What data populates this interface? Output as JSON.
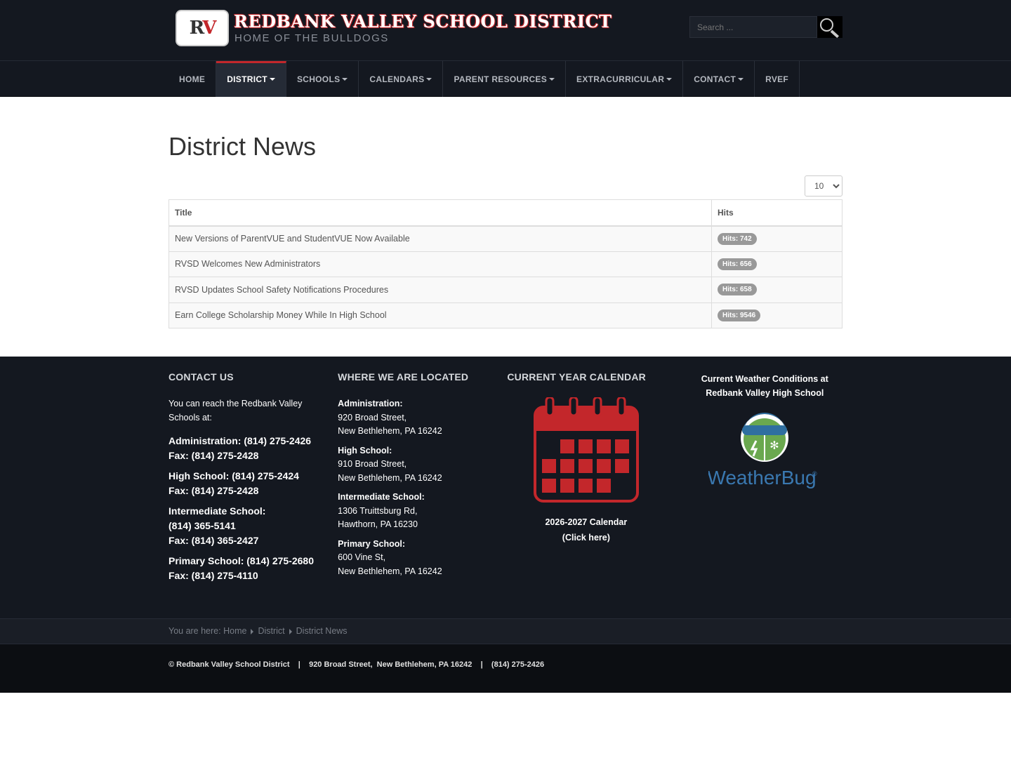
{
  "header": {
    "logo_text_r": "R",
    "logo_text_v": "V",
    "title": "REDBANK VALLEY SCHOOL DISTRICT",
    "subtitle": "HOME OF THE BULLDOGS",
    "search_placeholder": "Search ..."
  },
  "nav": {
    "items": [
      {
        "label": "HOME"
      },
      {
        "label": "DISTRICT"
      },
      {
        "label": "SCHOOLS"
      },
      {
        "label": "CALENDARS"
      },
      {
        "label": "PARENT RESOURCES"
      },
      {
        "label": "EXTRACURRICULAR"
      },
      {
        "label": "CONTACT"
      },
      {
        "label": "RVEF"
      }
    ]
  },
  "main": {
    "title": "District News",
    "limit_value": "10",
    "table": {
      "headers": [
        "Title",
        "Hits"
      ],
      "rows": [
        {
          "title": "New Versions of ParentVUE and StudentVUE Now Available",
          "hits": "Hits: 742"
        },
        {
          "title": "RVSD Welcomes New Administrators",
          "hits": "Hits: 656"
        },
        {
          "title": "RVSD Updates School Safety Notifications Procedures",
          "hits": "Hits: 658"
        },
        {
          "title": "Earn College Scholarship Money While In High School",
          "hits": "Hits: 9546"
        }
      ]
    }
  },
  "footer": {
    "contact": {
      "heading": "CONTACT US",
      "intro": "You can reach the Redbank Valley Schools at:",
      "lines": [
        [
          "Administration: (814) 275-2426",
          "Fax: (814) 275-2428"
        ],
        [
          "High School: (814) 275-2424",
          "Fax: (814) 275-2428"
        ],
        [
          "Intermediate School:",
          "(814) 365-5141",
          "Fax: (814) 365-2427"
        ],
        [
          "Primary School: (814) 275-2680",
          "Fax: (814) 275-4110"
        ]
      ]
    },
    "location": {
      "heading": "WHERE WE ARE LOCATED",
      "blocks": [
        {
          "label": "Administration:",
          "line1": "920 Broad Street,",
          "line2": "New Bethlehem, PA 16242"
        },
        {
          "label": "High School:",
          "line1": "910 Broad Street,",
          "line2": "New Bethlehem, PA 16242"
        },
        {
          "label": "Intermediate School:",
          "line1": "1306 Truittsburg Rd,",
          "line2": "Hawthorn, PA 16230"
        },
        {
          "label": "Primary School:",
          "line1": "600 Vine St,",
          "line2": "New Bethlehem, PA 16242"
        }
      ]
    },
    "calendar": {
      "heading": "CURRENT YEAR CALENDAR",
      "caption1": "2026-2027 Calendar",
      "caption2": "(Click here)",
      "icon": "calendar-icon",
      "color": "#c3272b"
    },
    "weather": {
      "title": "Current Weather Conditions at Redbank Valley High School",
      "logo_text": "WeatherBug",
      "registered": "®"
    }
  },
  "breadcrumb": {
    "prefix": "You are here:",
    "items": [
      "Home",
      "District",
      "District News"
    ]
  },
  "copyright": {
    "text": "© Redbank Valley School District    |    920 Broad Street,  New Bethlehem, PA 16242    |    (814) 275-2426"
  }
}
